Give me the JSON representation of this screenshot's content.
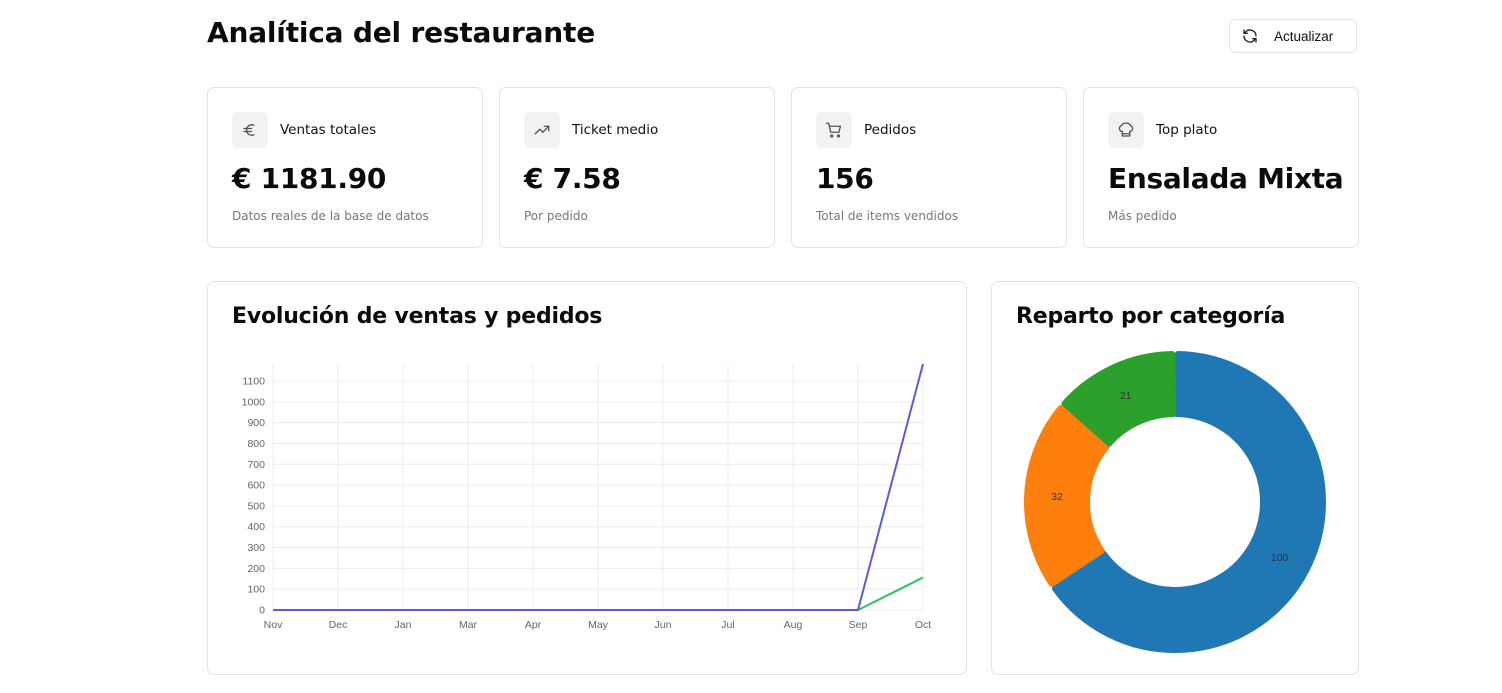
{
  "header": {
    "title": "Analítica del restaurante",
    "refresh_label": "Actualizar"
  },
  "kpis": [
    {
      "icon": "euro-icon",
      "label": "Ventas totales",
      "value": "€ 1181.90",
      "sub": "Datos reales de la base de datos"
    },
    {
      "icon": "trending-up-icon",
      "label": "Ticket medio",
      "value": "€ 7.58",
      "sub": "Por pedido"
    },
    {
      "icon": "cart-icon",
      "label": "Pedidos",
      "value": "156",
      "sub": "Total de items vendidos"
    },
    {
      "icon": "chef-hat-icon",
      "label": "Top plato",
      "value": "Ensalada Mixta",
      "sub": "Más pedido"
    }
  ],
  "line_panel": {
    "title": "Evolución de ventas y pedidos"
  },
  "donut_panel": {
    "title": "Reparto por categoría"
  },
  "chart_data": [
    {
      "type": "line",
      "categories": [
        "Nov",
        "Dec",
        "Jan",
        "Mar",
        "Apr",
        "May",
        "Jun",
        "Jul",
        "Aug",
        "Sep",
        "Oct"
      ],
      "series": [
        {
          "color": "#5b5bd6",
          "values": [
            0,
            0,
            0,
            0,
            0,
            0,
            0,
            0,
            0,
            0,
            1181.9
          ]
        },
        {
          "color": "#22c55e",
          "values": [
            0,
            0,
            0,
            0,
            0,
            0,
            0,
            0,
            0,
            0,
            156
          ]
        }
      ],
      "yticks": [
        0,
        100,
        200,
        300,
        400,
        500,
        600,
        700,
        800,
        900,
        1000,
        1100
      ],
      "ylim": [
        0,
        1181.9
      ],
      "grid": true
    },
    {
      "type": "pie",
      "variant": "donut",
      "slices": [
        {
          "value": 100,
          "color": "#1f77b4"
        },
        {
          "value": 32,
          "color": "#ff7f0e"
        },
        {
          "value": 21,
          "color": "#2ca02c"
        }
      ]
    }
  ]
}
